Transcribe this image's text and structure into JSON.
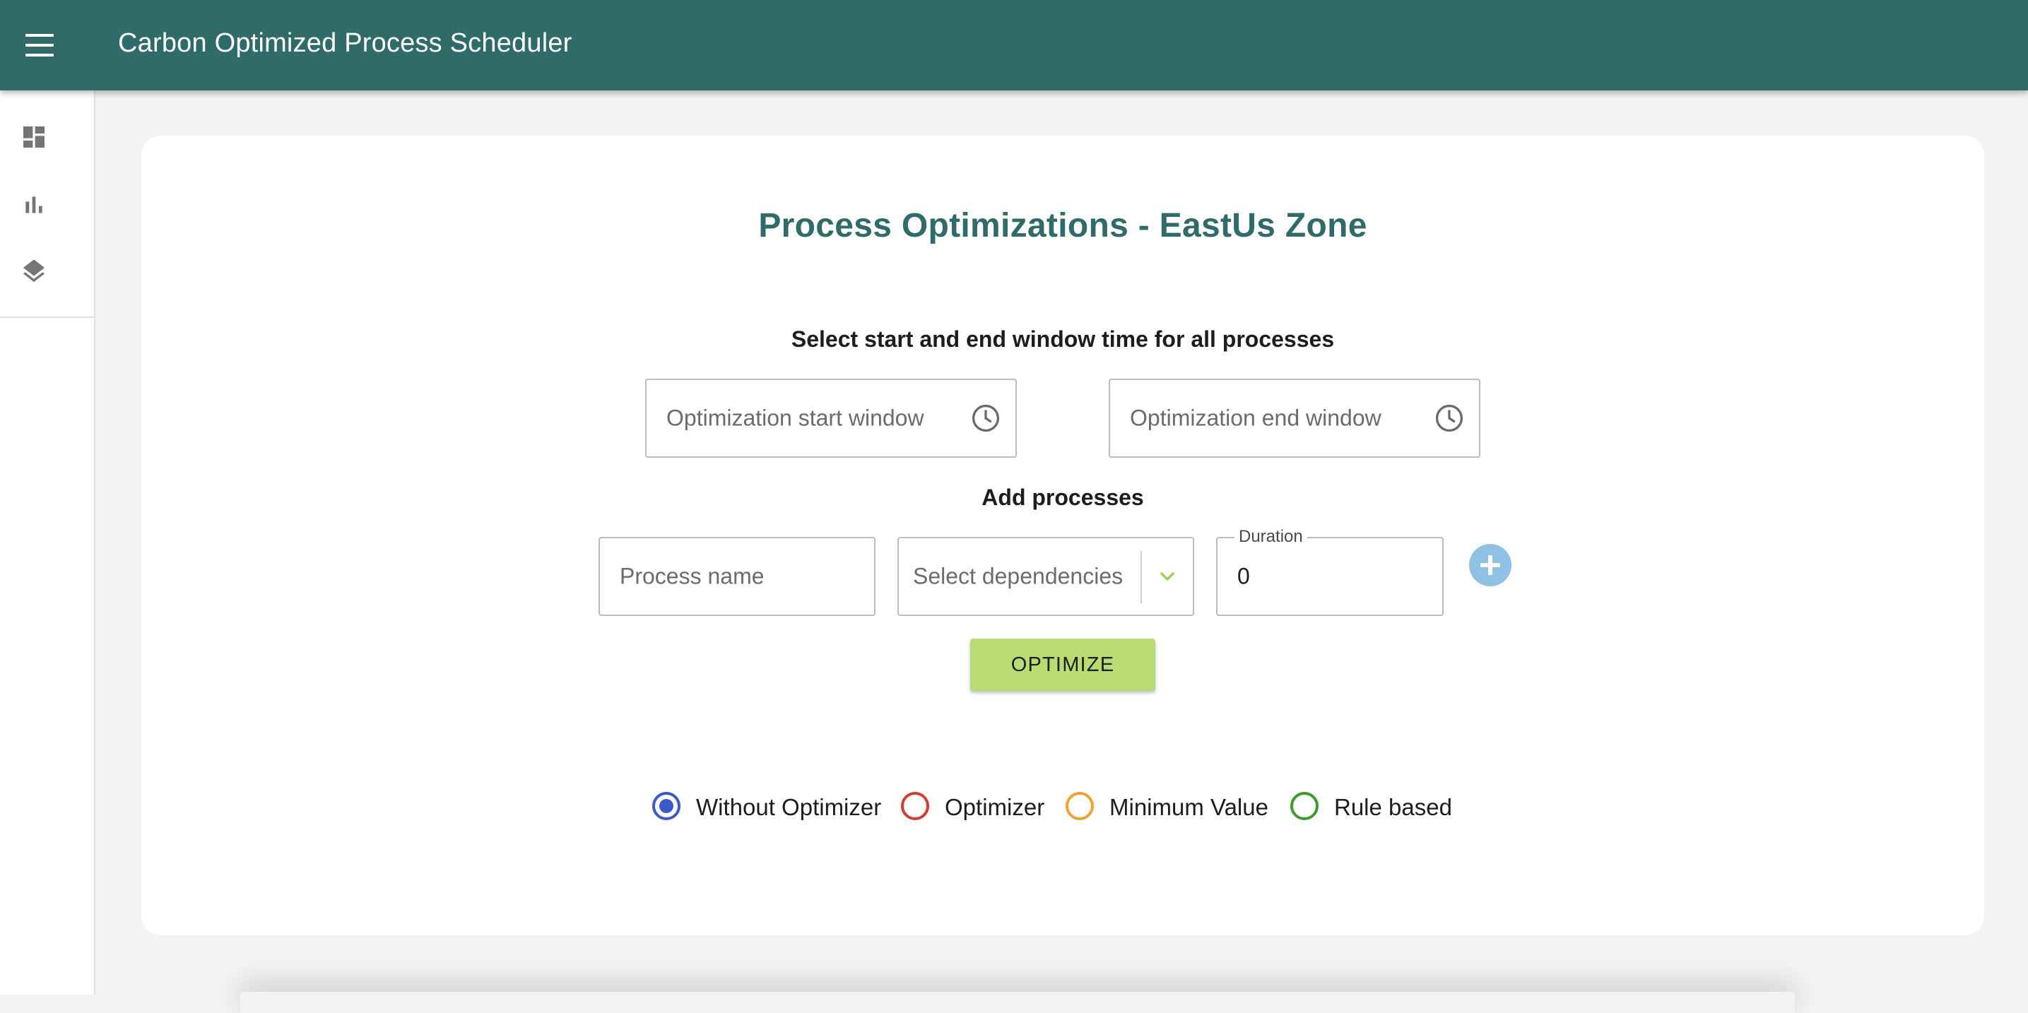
{
  "app": {
    "title": "Carbon Optimized Process Scheduler"
  },
  "sidebar": {
    "items": [
      {
        "icon": "dashboard-icon"
      },
      {
        "icon": "bar-chart-icon"
      },
      {
        "icon": "layers-icon"
      }
    ]
  },
  "main": {
    "title": "Process Optimizations - EastUs Zone",
    "window_section_label": "Select start and end window time for all processes",
    "start_window": {
      "placeholder": "Optimization start window",
      "value": ""
    },
    "end_window": {
      "placeholder": "Optimization end window",
      "value": ""
    },
    "add_processes_label": "Add processes",
    "process_name": {
      "placeholder": "Process name",
      "value": ""
    },
    "dependencies": {
      "placeholder": "Select dependencies"
    },
    "duration": {
      "label": "Duration",
      "value": "0"
    },
    "optimize_button": "OPTIMIZE"
  },
  "legend": {
    "items": [
      {
        "label": "Without Optimizer",
        "color": "#3a5bc7",
        "checked": true
      },
      {
        "label": "Optimizer",
        "color": "#d23f2e",
        "checked": false
      },
      {
        "label": "Minimum Value",
        "color": "#f0a232",
        "checked": false
      },
      {
        "label": "Rule based",
        "color": "#3f9a2b",
        "checked": false
      }
    ]
  },
  "colors": {
    "appbar": "#2f6b69",
    "title": "#2f6b69",
    "optimize_button": "#b8dc72",
    "add_button": "#8fc1e3"
  }
}
